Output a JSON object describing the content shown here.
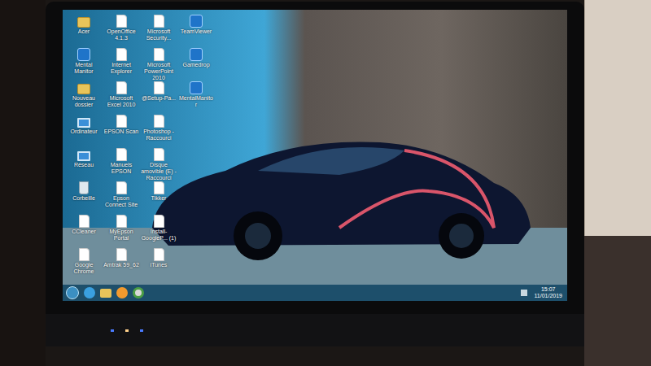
{
  "desktop": {
    "icons": [
      {
        "label": "Acer",
        "kind": "folder"
      },
      {
        "label": "Mental Manitor",
        "kind": "app"
      },
      {
        "label": "Nouveau dossier",
        "kind": "folder"
      },
      {
        "label": "Ordinateur",
        "kind": "system"
      },
      {
        "label": "Réseau",
        "kind": "system"
      },
      {
        "label": "Corbeille",
        "kind": "bin"
      },
      {
        "label": "CCleaner",
        "kind": "file"
      },
      {
        "label": "Google Chrome",
        "kind": "file"
      },
      {
        "label": "OpenOffice 4.1.3",
        "kind": "file"
      },
      {
        "label": "Internet Explorer",
        "kind": "file"
      },
      {
        "label": "Microsoft Excel 2010",
        "kind": "file"
      },
      {
        "label": "EPSON Scan",
        "kind": "file"
      },
      {
        "label": "Manuels EPSON",
        "kind": "file"
      },
      {
        "label": "Epson Connect Site",
        "kind": "file"
      },
      {
        "label": "MyEpson Portal",
        "kind": "file"
      },
      {
        "label": "Amtrak 59_62",
        "kind": "file"
      },
      {
        "label": "Microsoft Security...",
        "kind": "file"
      },
      {
        "label": "Microsoft PowerPoint 2010",
        "kind": "file"
      },
      {
        "label": "@Setup-Pa...",
        "kind": "file"
      },
      {
        "label": "Photoshop - Raccourci",
        "kind": "file"
      },
      {
        "label": "Disque amovible (E) - Raccourci",
        "kind": "file"
      },
      {
        "label": "Tikker",
        "kind": "file"
      },
      {
        "label": "Install-GoogleP... (1)",
        "kind": "file"
      },
      {
        "label": "iTunes",
        "kind": "file"
      },
      {
        "label": "TeamViewer",
        "kind": "app"
      },
      {
        "label": "Gamedrop",
        "kind": "app"
      },
      {
        "label": "MentalManitor",
        "kind": "app"
      }
    ]
  },
  "taskbar": {
    "time": "15:07",
    "date": "11/01/2019"
  }
}
